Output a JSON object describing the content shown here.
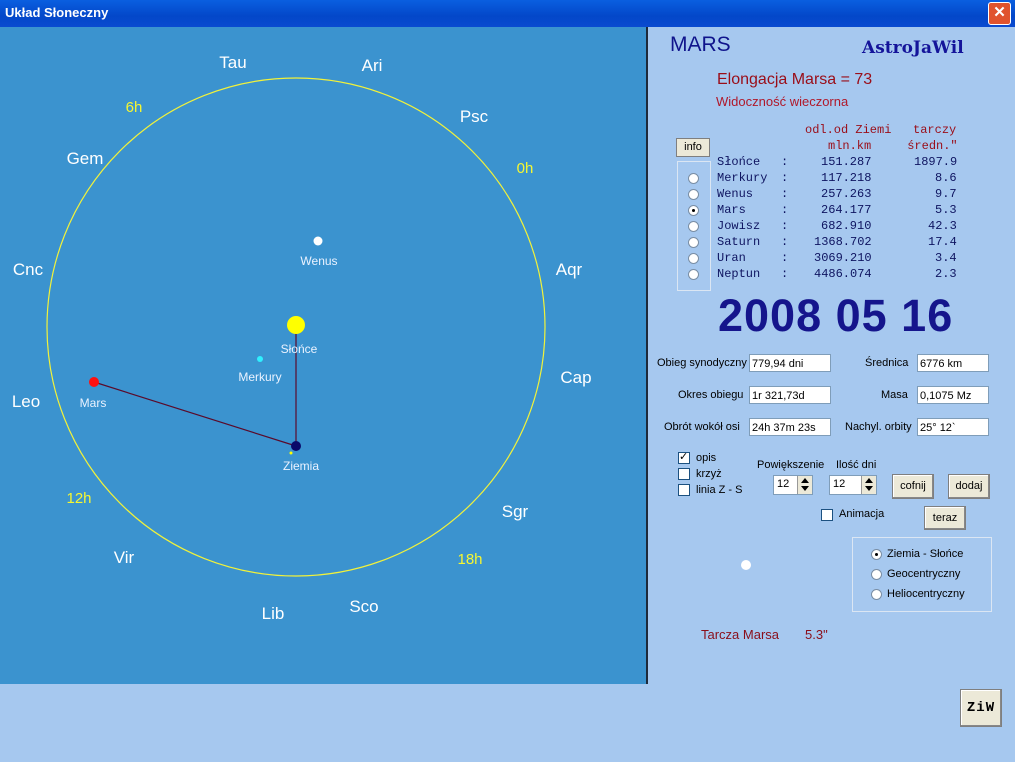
{
  "window": {
    "title": "Układ Słoneczny"
  },
  "sky": {
    "zodiac": [
      "Tau",
      "Ari",
      "Psc",
      "Aqr",
      "Cap",
      "Sgr",
      "Sco",
      "Lib",
      "Vir",
      "Leo",
      "Cnc",
      "Gem"
    ],
    "hours": [
      "6h",
      "0h",
      "12h",
      "18h"
    ],
    "bodies": {
      "wenus": "Wenus",
      "slonce": "Słońce",
      "merkury": "Merkury",
      "mars": "Mars",
      "ziemia": "Ziemia"
    }
  },
  "panel": {
    "planet": "MARS",
    "brand": "AstroJaWil",
    "elongation": "Elongacja Marsa = 73",
    "visibility": "Widoczność wieczorna",
    "info_label": "info",
    "table_header1": "odl.od Ziemi   tarczy",
    "table_header2": "mln.km     średn.\"",
    "rows": [
      {
        "name": "Słońce",
        "dist": "151.287",
        "disk": "1897.9"
      },
      {
        "name": "Merkury",
        "dist": "117.218",
        "disk": "8.6"
      },
      {
        "name": "Wenus",
        "dist": "257.263",
        "disk": "9.7"
      },
      {
        "name": "Mars",
        "dist": "264.177",
        "disk": "5.3"
      },
      {
        "name": "Jowisz",
        "dist": "682.910",
        "disk": "42.3"
      },
      {
        "name": "Saturn",
        "dist": "1368.702",
        "disk": "17.4"
      },
      {
        "name": "Uran",
        "dist": "3069.210",
        "disk": "3.4"
      },
      {
        "name": "Neptun",
        "dist": "4486.074",
        "disk": "2.3"
      }
    ],
    "selected_planet": "Mars",
    "date": "2008 05 16",
    "fields": {
      "obieg_label": "Obieg synodyczny",
      "obieg_value": "779,94 dni",
      "srednica_label": "Średnica",
      "srednica_value": "6776 km",
      "okres_label": "Okres obiegu",
      "okres_value": "1r 321,73d",
      "masa_label": "Masa",
      "masa_value": "0,1075 Mz",
      "obrot_label": "Obrót wokół osi",
      "obrot_value": "24h 37m 23s",
      "nachyl_label": "Nachyl. orbity",
      "nachyl_value": "25° 12`"
    },
    "options": {
      "opis": "opis",
      "krzyz": "krzyż",
      "linia": "linia  Z - S",
      "animacja": "Animacja"
    },
    "zoom": {
      "label": "Powiększenie",
      "value": "12"
    },
    "days": {
      "label": "Ilość dni",
      "value": "12"
    },
    "buttons": {
      "cofnij": "cofnij",
      "dodaj": "dodaj",
      "teraz": "teraz",
      "ziw": "ZiW"
    },
    "views": [
      "Ziemia - Słońce",
      "Geocentryczny",
      "Heliocentryczny"
    ],
    "disk_label": "Tarcza Marsa",
    "disk_value": "5.3\""
  },
  "colors": {
    "sky": "#3b93cf",
    "orbit": "#f2f23a",
    "panel": "#a6c8ef",
    "accent": "#15158c",
    "red": "#9a0d18"
  }
}
